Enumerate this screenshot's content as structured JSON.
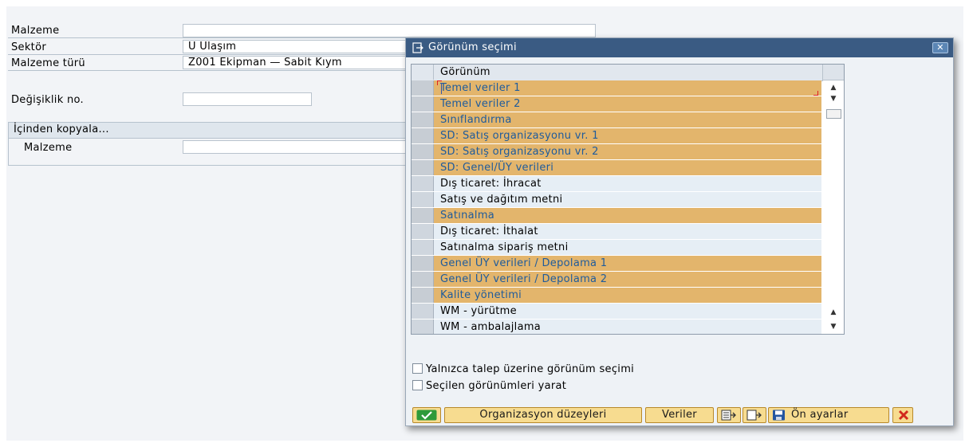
{
  "form": {
    "material_label": "Malzeme",
    "material_value": "",
    "sector_label": "Sektör",
    "sector_value": "U Ulaşım",
    "material_type_label": "Malzeme türü",
    "material_type_value": "Z001 Ekipman — Sabit Kıym",
    "change_no_label": "Değişiklik no.",
    "change_no_value": ""
  },
  "copy_from": {
    "title": "İçinden kopyala...",
    "material_label": "Malzeme",
    "material_value": ""
  },
  "dialog": {
    "title": "Görünüm seçimi",
    "column_header": "Görünüm",
    "rows": [
      {
        "label": "Temel veriler 1",
        "selected": true
      },
      {
        "label": "Temel veriler 2",
        "selected": true
      },
      {
        "label": "Sınıflandırma",
        "selected": true
      },
      {
        "label": "SD: Satış organizasyonu vr. 1",
        "selected": true
      },
      {
        "label": "SD: Satış organizasyonu vr. 2",
        "selected": true
      },
      {
        "label": "SD: Genel/ÜY verileri",
        "selected": true
      },
      {
        "label": "Dış ticaret: İhracat",
        "selected": false
      },
      {
        "label": "Satış ve dağıtım metni",
        "selected": false
      },
      {
        "label": "Satınalma",
        "selected": true
      },
      {
        "label": "Dış ticaret: İthalat",
        "selected": false
      },
      {
        "label": "Satınalma sipariş metni",
        "selected": false
      },
      {
        "label": "Genel ÜY verileri / Depolama 1",
        "selected": true
      },
      {
        "label": "Genel ÜY verileri / Depolama 2",
        "selected": true
      },
      {
        "label": "Kalite yönetimi",
        "selected": true
      },
      {
        "label": "WM  - yürütme",
        "selected": false
      },
      {
        "label": "WM - ambalajlama",
        "selected": false
      }
    ],
    "checkbox_on_request": "Yalnızca talep üzerine görünüm seçimi",
    "checkbox_create_selected": "Seçilen görünümleri yarat",
    "buttons": {
      "org_levels": "Organizasyon düzeyleri",
      "data": "Veriler",
      "defaults": "Ön ayarlar"
    }
  },
  "colors": {
    "selected_row": "#e3b56c",
    "unselected_row": "#e6eef5",
    "title_bar": "#3a5b83",
    "button": "#f7dc90"
  },
  "icons": [
    "dialog-icon",
    "close-icon",
    "check-icon",
    "select-all-icon",
    "deselect-all-icon",
    "save-icon",
    "cancel-icon"
  ]
}
